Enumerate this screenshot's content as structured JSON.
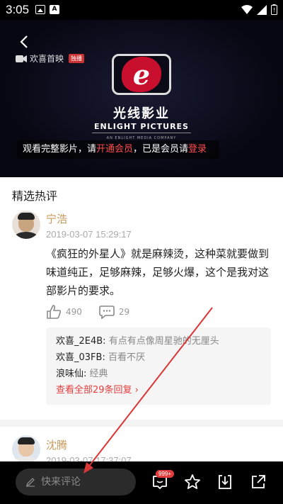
{
  "status_bar": {
    "time": "3:05"
  },
  "video": {
    "brand_name": "欢喜首映",
    "brand_badge": "独播",
    "logo_cn": "光线影业",
    "logo_en": "ENLIGHT PICTURES",
    "logo_sub": "AN ENLIGHT MEDIA COMPANY",
    "vip_prompt_before": "观看完整影片，请",
    "vip_open_link": "开通会员",
    "vip_prompt_mid": "，已是会员请",
    "vip_login_link": "登录"
  },
  "section_title": "精选热评",
  "comments": [
    {
      "author": "宁浩",
      "time": "2019-03-07 15:29:17",
      "text": "《疯狂的外星人》就是麻辣烫，这种菜就要做到味道纯正，足够麻辣，足够火爆，这个是我对这部影片的要求。",
      "likes": "490",
      "reply_count": "29",
      "replies": [
        {
          "user": "欢喜_2E4B: ",
          "text": "有点有点像周星驰的无厘头"
        },
        {
          "user": "欢喜_03FB: ",
          "text": "百看不厌"
        },
        {
          "user": "浪味仙: ",
          "text": "经典"
        }
      ],
      "view_all": "查看全部29条回复 ›"
    },
    {
      "author": "沈腾",
      "time": "2019-03-07 17:37:07"
    }
  ],
  "bottom_bar": {
    "comment_placeholder": "快来评论",
    "message_badge": "999+"
  },
  "colors": {
    "accent_red": "#e43d3d",
    "author_gold": "#c9985a",
    "annotation_arrow": "#d93636"
  },
  "icons": [
    "back-arrow-icon",
    "like-icon",
    "comment-icon",
    "message-icon",
    "star-icon",
    "download-icon",
    "share-icon",
    "pencil-icon"
  ]
}
